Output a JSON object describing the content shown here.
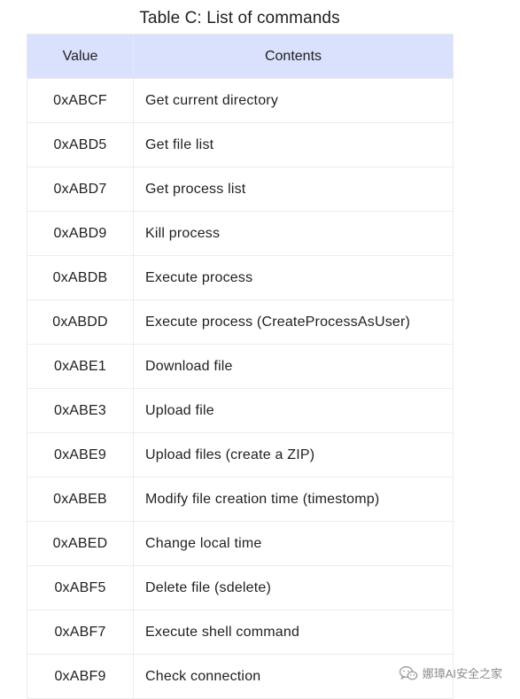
{
  "caption": "Table C: List of commands",
  "table": {
    "headers": [
      "Value",
      "Contents"
    ],
    "rows": [
      [
        "0xABCF",
        "Get current directory"
      ],
      [
        "0xABD5",
        "Get file list"
      ],
      [
        "0xABD7",
        "Get process list"
      ],
      [
        "0xABD9",
        "Kill process"
      ],
      [
        "0xABDB",
        "Execute process"
      ],
      [
        "0xABDD",
        "Execute process (CreateProcessAsUser)"
      ],
      [
        "0xABE1",
        "Download file"
      ],
      [
        "0xABE3",
        "Upload file"
      ],
      [
        "0xABE9",
        "Upload files (create a ZIP)"
      ],
      [
        "0xABEB",
        "Modify file creation time (timestomp)"
      ],
      [
        "0xABED",
        "Change local time"
      ],
      [
        "0xABF5",
        "Delete file (sdelete)"
      ],
      [
        "0xABF7",
        "Execute shell command"
      ],
      [
        "0xABF9",
        "Check connection"
      ]
    ]
  },
  "watermark": {
    "text": "娜璋AI安全之家",
    "icon": "wechat-icon"
  }
}
